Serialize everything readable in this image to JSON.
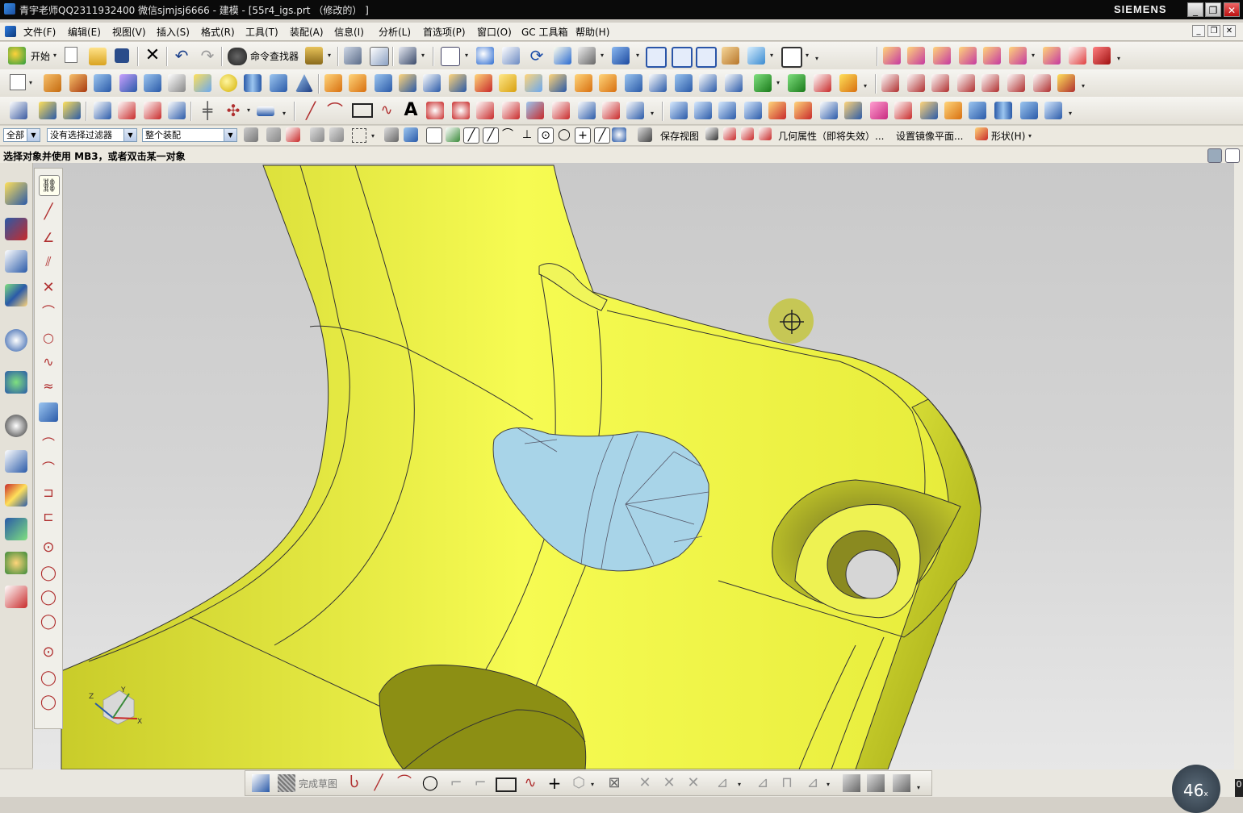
{
  "window": {
    "title": "青宇老师QQ2311932400 微信sjmjsj6666 - 建模 - [55r4_igs.prt （修改的） ]",
    "brand": "SIEMENS",
    "controls": {
      "minimize": "_",
      "restore": "❐",
      "close": "✕"
    }
  },
  "menubar": {
    "items": [
      "文件(F)",
      "编辑(E)",
      "视图(V)",
      "插入(S)",
      "格式(R)",
      "工具(T)",
      "装配(A)",
      "信息(I)",
      "分析(L)",
      "首选项(P)",
      "窗口(O)",
      "GC 工具箱",
      "帮助(H)"
    ]
  },
  "toolbar1": {
    "start_label": "开始",
    "command_finder_label": "命令查找器"
  },
  "selection_bar": {
    "type_filter": "全部",
    "selection_filter": "没有选择过滤器",
    "scope": "整个装配",
    "save_view": "保存视图",
    "geometry_props": "几何属性（即将失效）...",
    "mirror_plane": "设置镜像平面...",
    "shape_menu": "形状(H)"
  },
  "status": {
    "prompt": "选择对象并使用 MB3，或者双击某一对象"
  },
  "viewport": {
    "part_color": "#f0f54a",
    "highlight_color": "#a8d4e8",
    "background_top": "#c9c9c9",
    "triad": {
      "x": "X",
      "y": "Y",
      "z": "Z"
    }
  },
  "sketch_toolbar": {
    "finish_label": "完成草图"
  },
  "zoom_badge": {
    "value": "46",
    "unit": "x"
  },
  "corner_text": "0"
}
